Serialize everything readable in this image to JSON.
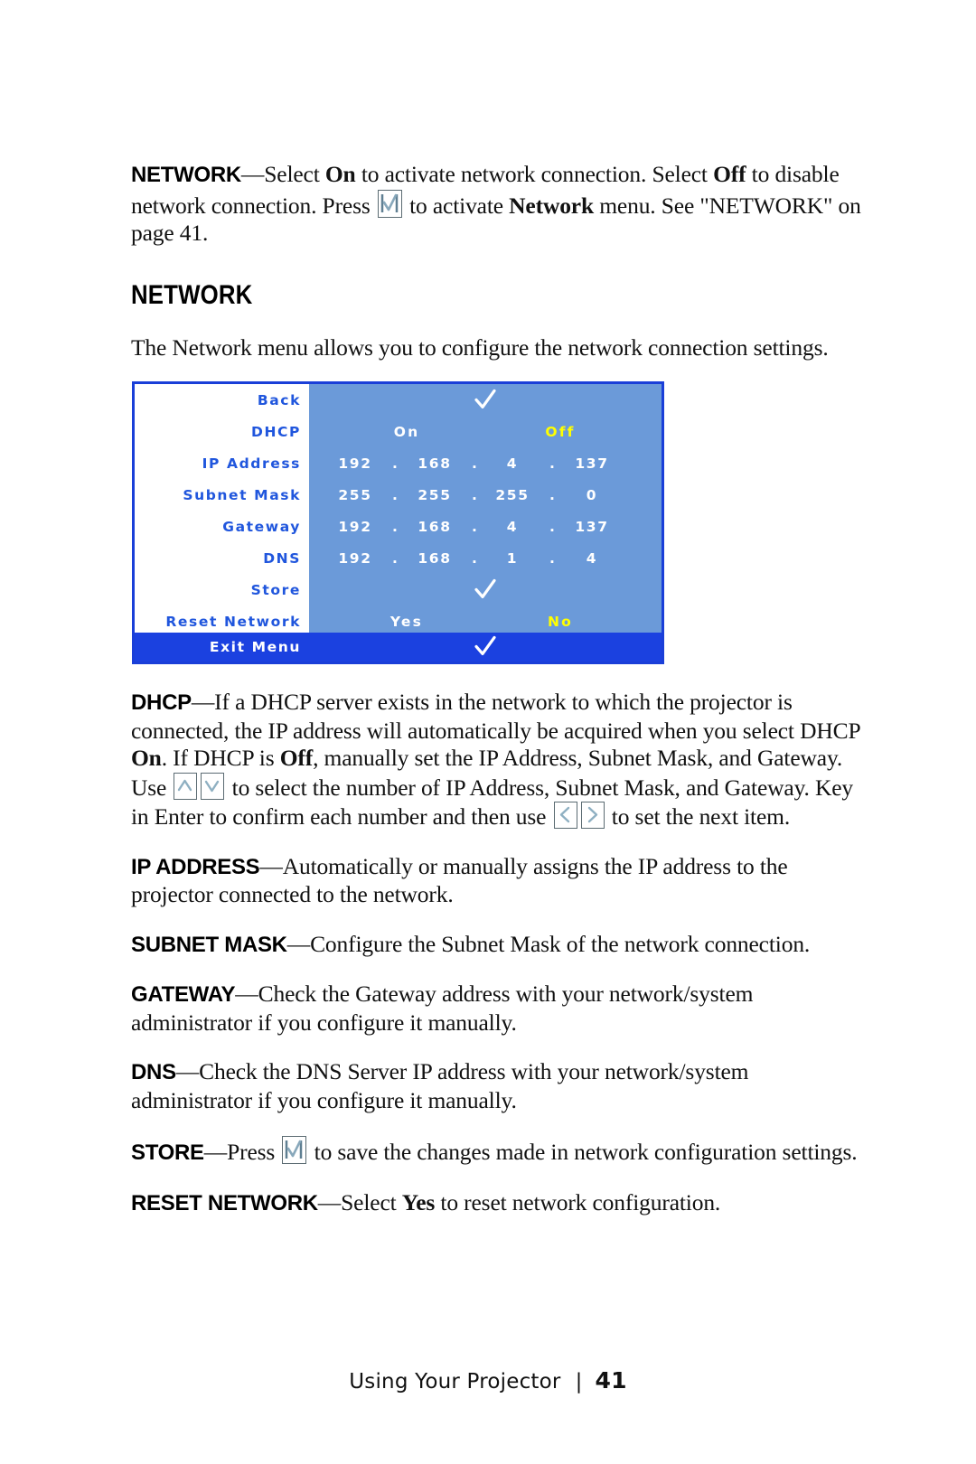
{
  "document": {
    "paragraphs": {
      "network_intro": {
        "term": "NETWORK",
        "text_1": "—Select ",
        "bold_1": "On",
        "text_2": " to activate network connection. Select ",
        "bold_2": "Off",
        "text_3": " to disable network connection. Press ",
        "icon_1": "enter-key-icon",
        "text_4": " to activate ",
        "bold_3": "Network",
        "text_5": " menu. See \"NETWORK\" on page 41."
      },
      "section_heading": "NETWORK",
      "section_intro": "The Network menu allows you to configure the network connection settings.",
      "dhcp": {
        "term": "DHCP",
        "text_1": "—If a DHCP server exists in the network to which the projector is connected, the IP address will automatically be acquired when you select DHCP ",
        "bold_1": "On",
        "text_2": ". If DHCP is ",
        "bold_2": "Off",
        "text_3": ", manually set the IP Address, Subnet Mask, and Gateway. Use ",
        "icon_1": "arrow-up-key-icon",
        "icon_2": "arrow-down-key-icon",
        "text_4": " to select the number of IP Address, Subnet Mask, and Gateway. Key in Enter to confirm each number and then use ",
        "icon_3": "arrow-left-key-icon",
        "icon_4": "arrow-right-key-icon",
        "text_5": " to set the next item."
      },
      "ip_address": {
        "term_1": "IP",
        "term_2": "ADDRESS",
        "text": "—Automatically or manually assigns the IP address to the projector connected to the network."
      },
      "subnet_mask": {
        "term_1": "SUBNET",
        "term_2": "MASK",
        "text": "—Configure the Subnet Mask of the network connection."
      },
      "gateway": {
        "term": "GATEWAY",
        "text": "—Check the Gateway address with your network/system administrator if you configure it manually."
      },
      "dns": {
        "term": "DNS",
        "text": "—Check the DNS Server IP address with your network/system administrator if you configure it manually."
      },
      "store": {
        "term": "STORE",
        "text_1": "—Press ",
        "icon_1": "enter-key-icon",
        "text_2": " to save the changes made in network configuration settings."
      },
      "reset_network": {
        "term_1": "RESET",
        "term_2": "NETWORK",
        "text_1": "—Select ",
        "bold_1": "Yes",
        "text_2": " to reset network configuration."
      }
    }
  },
  "osd_menu": {
    "colors": {
      "border": "#1a3fd8",
      "label_text": "#2056dd",
      "value_pane": "#6b9ad9",
      "label_pane": "#ffffff",
      "value_text": "#ffffff",
      "highlight_text": "#ffff00",
      "exit_bar": "#1b41e0"
    },
    "rows": [
      {
        "label": "Back",
        "type": "check"
      },
      {
        "label": "DHCP",
        "type": "options",
        "option_selected": "On",
        "option_other": "Off"
      },
      {
        "label": "IP Address",
        "type": "ip",
        "octets": [
          "192",
          "168",
          "4",
          "137"
        ]
      },
      {
        "label": "Subnet Mask",
        "type": "ip",
        "octets": [
          "255",
          "255",
          "255",
          "0"
        ]
      },
      {
        "label": "Gateway",
        "type": "ip",
        "octets": [
          "192",
          "168",
          "4",
          "137"
        ]
      },
      {
        "label": "DNS",
        "type": "ip",
        "octets": [
          "192",
          "168",
          "1",
          "4"
        ]
      },
      {
        "label": "Store",
        "type": "check"
      },
      {
        "label": "Reset Network",
        "type": "options",
        "option_selected": "Yes",
        "option_other": "No"
      }
    ],
    "exit_row": {
      "label": "Exit Menu",
      "type": "check"
    },
    "separator": "."
  },
  "footer": {
    "chapter": "Using Your Projector",
    "separator": "|",
    "page_number": "41"
  }
}
